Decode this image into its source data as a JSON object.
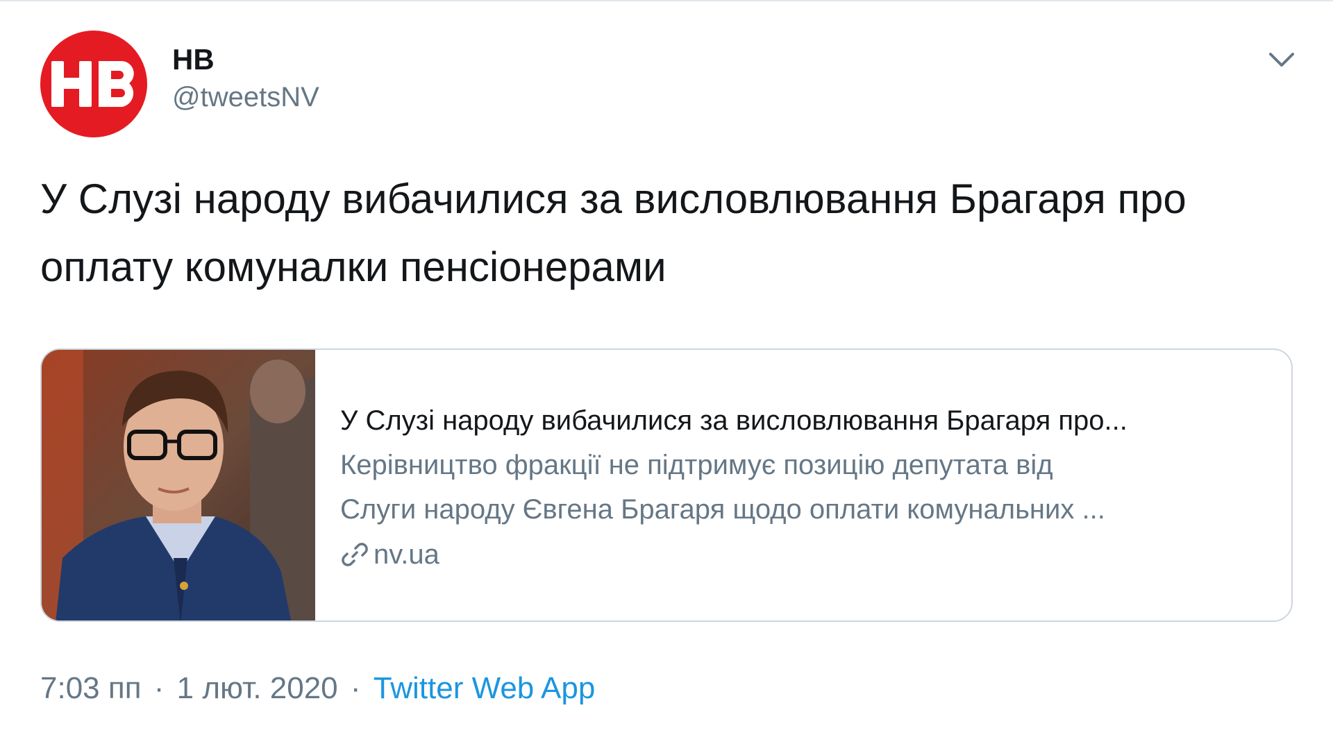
{
  "tweet": {
    "author": {
      "name": "НВ",
      "handle": "@tweetsNV",
      "avatar_icon": "nv-logo-icon",
      "avatar_color": "#e51b23"
    },
    "menu_icon": "chevron-down-icon",
    "text": "У Слузі народу вибачилися за висловлювання Брагаря про оплату комуналки пенсіонерами",
    "card": {
      "image_icon": "article-photo",
      "title": "У Слузі народу вибачилися за висловлювання Брагаря про...",
      "description_lines": [
        "Керівництво фракції не підтримує позицію депутата від",
        "Слуги народу Євгена Брагаря щодо оплати комунальних ..."
      ],
      "link_icon": "link-icon",
      "domain": "nv.ua"
    },
    "meta": {
      "time": "7:03 пп",
      "separator": "·",
      "date": "1 лют. 2020",
      "source": "Twitter Web App",
      "source_color": "#1b95e0"
    }
  }
}
